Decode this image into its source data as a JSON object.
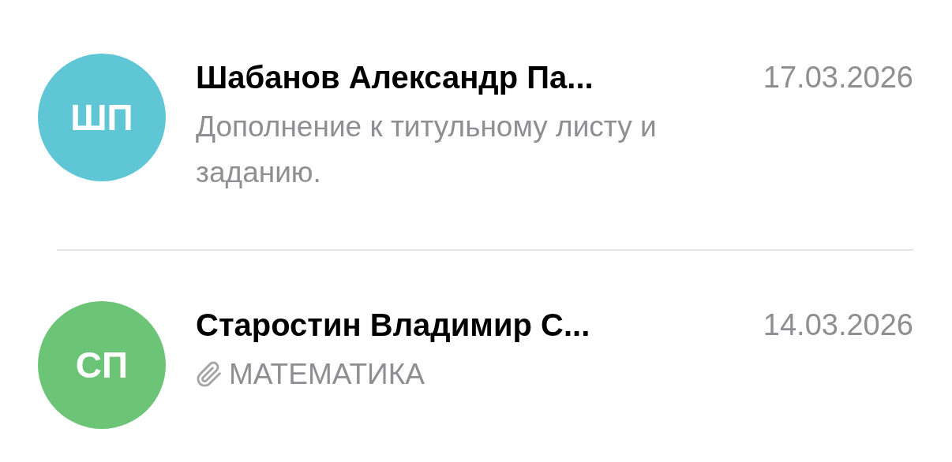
{
  "chats": [
    {
      "initials": "ШП",
      "color": "#5fc6d6",
      "name": "Шабанов Александр Па...",
      "date": "17.03.2026",
      "attachment": false,
      "preview": "Дополнение к титульному листу и заданию."
    },
    {
      "initials": "СП",
      "color": "#6cc476",
      "name": "Старостин Владимир С...",
      "date": "14.03.2026",
      "attachment": true,
      "preview": "МАТЕМАТИКА"
    }
  ]
}
